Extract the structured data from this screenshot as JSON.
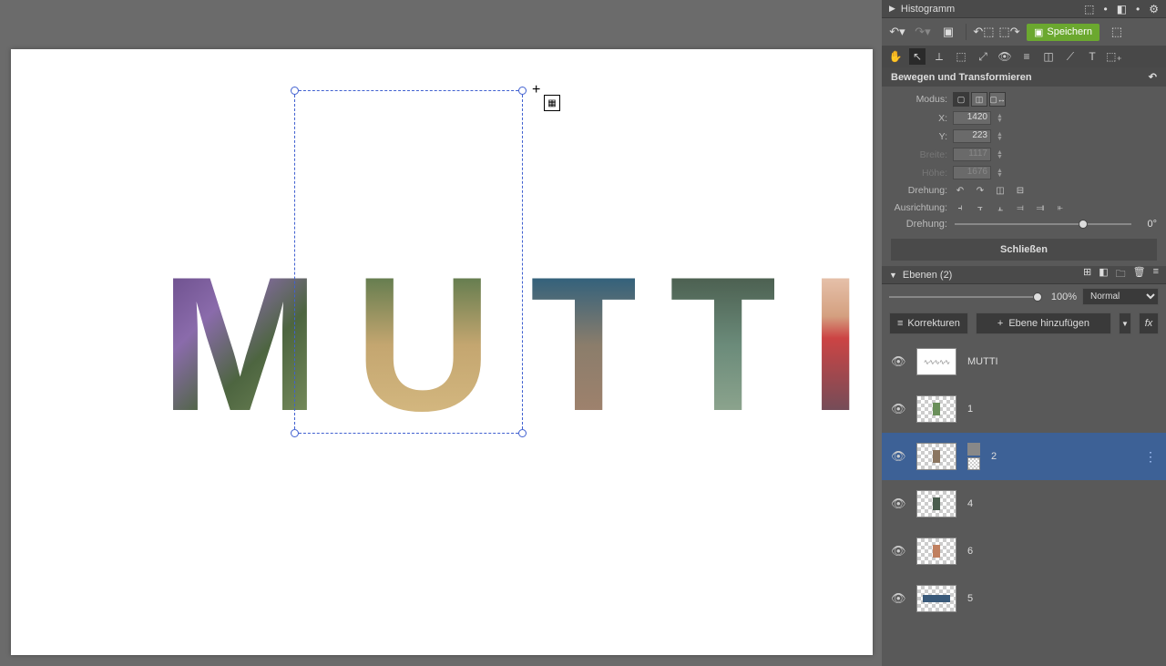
{
  "canvas": {
    "text": "MUTTI"
  },
  "panels": {
    "histogram_title": "Histogramm",
    "transform_title": "Bewegen und Transformieren",
    "layers_title": "Ebenen (2)"
  },
  "toolbar": {
    "save_label": "Speichern"
  },
  "transform": {
    "modus_label": "Modus:",
    "x_label": "X:",
    "x_value": "1420",
    "y_label": "Y:",
    "y_value": "223",
    "breite_label": "Breite:",
    "breite_value": "1117",
    "hoehe_label": "Höhe:",
    "hoehe_value": "1676",
    "drehung_label": "Drehung:",
    "ausrichtung_label": "Ausrichtung:",
    "drehung2_label": "Drehung:",
    "drehung2_value": "0°",
    "close_label": "Schließen"
  },
  "layers": {
    "opacity_value": "100%",
    "blend_mode": "Normal",
    "korrekturen_label": "Korrekturen",
    "add_layer_label": "Ebene hinzufügen",
    "fx_label": "fx",
    "items": [
      {
        "name": "MUTTI"
      },
      {
        "name": "1"
      },
      {
        "name": "2"
      },
      {
        "name": "4"
      },
      {
        "name": "6"
      },
      {
        "name": "5"
      }
    ]
  }
}
